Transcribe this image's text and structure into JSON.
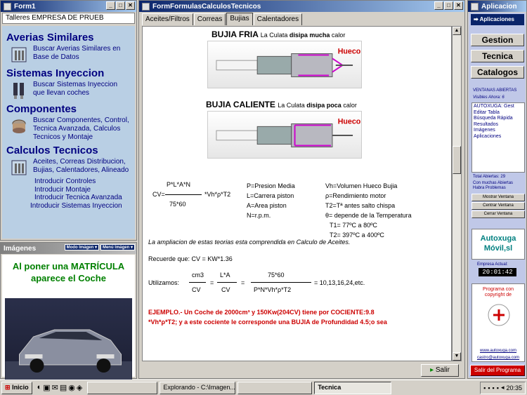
{
  "form1": {
    "title": "Form1",
    "company": "Talleres EMPRESA DE PRUEB",
    "sections": [
      {
        "heading": "Averias Similares",
        "text": "Buscar Averias Similares en Base de Datos"
      },
      {
        "heading": "Sistemas Inyeccion",
        "text": "Buscar Sistemas Inyeccion que llevan coches"
      },
      {
        "heading": "Componentes",
        "text": "Buscar Componentes, Control, Tecnica Avanzada, Calculos Tecnicos y Montaje"
      },
      {
        "heading": "Calculos Tecnicos",
        "text": "Aceites, Correas Distribucion, Bujias, Calentadores, Alineado"
      }
    ],
    "links": [
      "Introducir Controles",
      "Introducir Montaje",
      "Introducir Tecnica Avanzada",
      "Introducir Sistemas Inyeccion"
    ]
  },
  "images": {
    "title": "Imágenes",
    "mode_btn": "Modo Imágen",
    "menu_btn": "Menú Imágen",
    "plate_text_line1": "Al poner una MATRÍCULA",
    "plate_text_line2": "aparece el Coche"
  },
  "main": {
    "title": "FormFormulasCalculosTecnicos",
    "tabs": [
      "Aceites/Filtros",
      "Correas",
      "Bujias",
      "Calentadores"
    ],
    "active_tab": 2,
    "fria_title": "BUJIA FRIA",
    "fria_sub1": "La Culata",
    "fria_sub2": "disipa mucha",
    "fria_sub3": "calor",
    "caliente_title": "BUJIA CALIENTE",
    "caliente_sub1": "La Culata",
    "caliente_sub2": "disipa poca",
    "caliente_sub3": "calor",
    "hueco": "Hueco",
    "formula_num": "P*L*A*N",
    "formula_cv": "CV=",
    "formula_den": "75*60",
    "formula_mul": "*Vh*ρ*T2",
    "legend_left": [
      "P=Presion Media",
      "L=Carrera piston",
      "A=Area piston",
      "N=r.p.m."
    ],
    "legend_right": [
      "Vh=Volumen Hueco Bujia",
      "ρ=Rendimiento motor",
      "T2=Tª antes salto chispa",
      "θ= depende de la Temperatura",
      "T1= 77ºC a 80ºC",
      "T2= 397ºC a 400ºC"
    ],
    "ampliacion": "La ampliacion de estas teorias esta comprendida en Calculo de Aceites.",
    "recuerde": "Recuerde que: CV = KW*1.36",
    "utilizamos": "Utilizamos:",
    "cm3": "cm3",
    "cv": "CV",
    "la": "L*A",
    "n7560": "75*60",
    "pnv": "P*N*Vh*ρ*T2",
    "result": "= 10,13,16,24,etc.",
    "ejemplo1": "EJEMPLO.- Un Coche de 2000cm³ y 150Kw(204CV) tiene por COCIENTE:9.8",
    "ejemplo2": "*Vh*ρ*T2; y a este cociente le corresponde una BUJIA de Profundidad 4.5;o sea",
    "salir": "Salir"
  },
  "right": {
    "title": "Aplicacion",
    "aplicaciones": "Aplicaciones",
    "buttons": [
      "Gestion",
      "Tecnica",
      "Catalogos"
    ],
    "ventanas_title": "VENTANAS ABIERTAS",
    "visibles": "Visibles Ahora: 6",
    "list": [
      "AUTOXUGA: Gest",
      "Editar Tabla",
      "Búsqueda Rápida",
      "Resultados",
      "Imágenes",
      "Aplicaciones"
    ],
    "total": "Total Abiertas: 29",
    "muchas": "Con muchas Abiertas Habra Problemas",
    "win_btns": [
      "Mostrar Ventana",
      "Centrar Ventana",
      "Cerrar Ventana"
    ],
    "brand1": "Autoxuga",
    "brand2": "Móvil,sl",
    "empresa": "Empresa Actual:",
    "clock": "20:01:42",
    "copyright": "Programa con copyright de",
    "web": "www.autoxuga.com",
    "email": "castro@autoxuga.com",
    "salir_programa": "Salir del Programa"
  },
  "taskbar": {
    "start": "Inicio",
    "items": [
      "Explorando - C:\\Imagen...",
      "",
      "Tecnica"
    ],
    "clock": "20:35"
  }
}
